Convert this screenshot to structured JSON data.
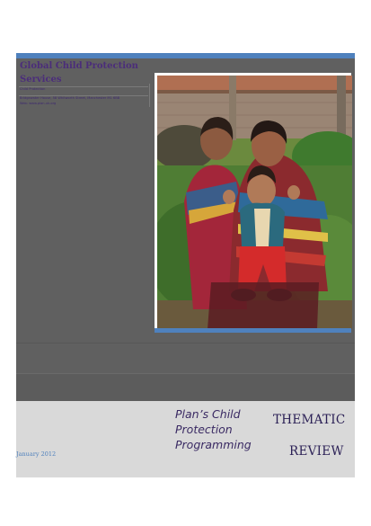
{
  "header": {
    "organization": "Global Child Protection Services",
    "contact_line_1": "Child Protection",
    "contact_line_2": "Bridgewater House, 58 Whitworth Street, Manchester M1 6BB",
    "contact_line_3": "Web: www.plan-uk.org"
  },
  "cover": {
    "date": "January 2012",
    "program_title": "Plan’s Child Protection Programming",
    "thematic": "THEMATIC",
    "review": "REVIEW"
  },
  "colors": {
    "accent": "#4f81bd",
    "panel": "#606060",
    "title_text": "#2a1f55"
  }
}
